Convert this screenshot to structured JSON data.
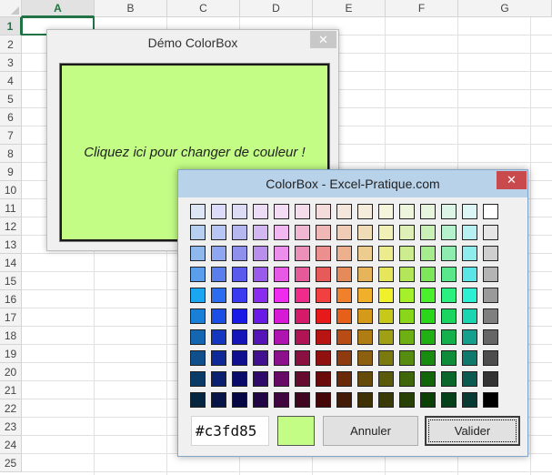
{
  "spreadsheet": {
    "columns": [
      "A",
      "B",
      "C",
      "D",
      "E",
      "F",
      "G"
    ],
    "rows": [
      "1",
      "2",
      "3",
      "4",
      "5",
      "6",
      "7",
      "8",
      "9",
      "10",
      "11",
      "12",
      "13",
      "14",
      "15",
      "16",
      "17",
      "18",
      "19",
      "20",
      "21",
      "22",
      "23",
      "24",
      "25"
    ],
    "selected_column": "A",
    "selected_row": "1"
  },
  "demo_window": {
    "title": "Démo ColorBox",
    "close_glyph": "✕",
    "button_text": "Cliquez ici pour changer de couleur !",
    "button_color": "#c3fd85"
  },
  "colorbox": {
    "title": "ColorBox - Excel-Pratique.com",
    "close_glyph": "✕",
    "hex_value": "#c3fd85",
    "preview_color": "#c3fd85",
    "cancel_label": "Annuler",
    "ok_label": "Valider",
    "palette": [
      [
        "#dce6f5",
        "#dcdcfa",
        "#dcdcf5",
        "#ecdcf5",
        "#f5dcf5",
        "#f5dcec",
        "#f5dcdc",
        "#f5e6dc",
        "#f5ecdc",
        "#f5f5dc",
        "#eef5dc",
        "#e6f5dc",
        "#dcf5e6",
        "#dcf5f5",
        "#ffffff"
      ],
      [
        "#b7d0f0",
        "#b7c6f5",
        "#b7b7f0",
        "#d2b7f0",
        "#f0b7f0",
        "#f0b7d2",
        "#f0b7b7",
        "#f0ccb7",
        "#f0dcb7",
        "#f0f0b7",
        "#def0b7",
        "#c8f0b7",
        "#b7f0cc",
        "#b7f0f0",
        "#e6e6e6"
      ],
      [
        "#8fb9ec",
        "#8fa6f0",
        "#8f8fec",
        "#b98fec",
        "#ec8fec",
        "#ec8fb9",
        "#ec8f8f",
        "#ecb08f",
        "#eccc8f",
        "#ecec8f",
        "#ccec8f",
        "#a6ec8f",
        "#8fecb0",
        "#8fecec",
        "#cfcfcf"
      ],
      [
        "#5a9eec",
        "#5a7eec",
        "#5a5aec",
        "#9a5aec",
        "#e65ae6",
        "#e65a9a",
        "#e65a5a",
        "#e68a5a",
        "#e6b45a",
        "#e6e65a",
        "#b4e65a",
        "#7ee65a",
        "#5ae68a",
        "#5ae6e6",
        "#b4b4b4"
      ],
      [
        "#1aa6f0",
        "#2b6cf0",
        "#3a3af0",
        "#8a2bf0",
        "#f02bf0",
        "#f02b8a",
        "#f04040",
        "#f0802b",
        "#f0b02b",
        "#f0f02b",
        "#a6f02b",
        "#4af02b",
        "#2bf080",
        "#2bf0d2",
        "#9a9a9a"
      ],
      [
        "#1a7fd6",
        "#1a4ee6",
        "#1a1ae6",
        "#6a1ae6",
        "#d61ad6",
        "#d61a6a",
        "#e61a1a",
        "#e6601a",
        "#d69a1a",
        "#c8c81a",
        "#8ad61a",
        "#2ad61a",
        "#1ad660",
        "#1ad6b0",
        "#7f7f7f"
      ],
      [
        "#1466b0",
        "#1436c0",
        "#1414b8",
        "#5414b8",
        "#b014b0",
        "#b01454",
        "#b81414",
        "#b84c14",
        "#b07c14",
        "#a0a014",
        "#6eb014",
        "#20b014",
        "#14b04c",
        "#14a08c",
        "#666666"
      ],
      [
        "#0f4f8c",
        "#0f2a98",
        "#0f0f90",
        "#420f90",
        "#8c0f8c",
        "#8c0f42",
        "#900f0f",
        "#903a0f",
        "#8c600f",
        "#7a7a0f",
        "#568c0f",
        "#188c0f",
        "#0f8c3a",
        "#0f7a6c",
        "#4d4d4d"
      ],
      [
        "#0a3a66",
        "#0a1f70",
        "#0a0a6a",
        "#300a6a",
        "#660a66",
        "#660a30",
        "#6a0a0a",
        "#6a2a0a",
        "#664a0a",
        "#5a5a0a",
        "#3f660a",
        "#12660a",
        "#0a662a",
        "#0a5a4f",
        "#333333"
      ],
      [
        "#062640",
        "#061448",
        "#060644",
        "#200644",
        "#400640",
        "#40061f",
        "#440606",
        "#441b06",
        "#403006",
        "#3a3a06",
        "#284006",
        "#0b4006",
        "#06401b",
        "#063a33",
        "#000000"
      ]
    ]
  }
}
